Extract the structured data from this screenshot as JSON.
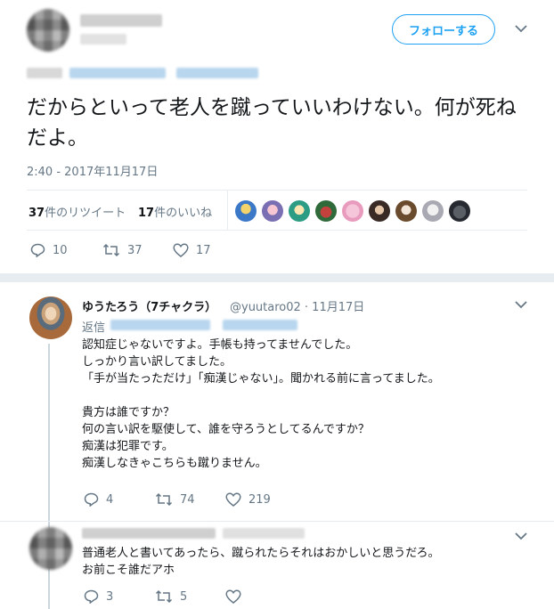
{
  "tweet": {
    "follow_label": "フォローする",
    "text": "だからといって老人を蹴っていいわけない。何が死ねだよ。",
    "timestamp": "2:40 - 2017年11月17日",
    "retweets_count": "37",
    "retweets_label": "件のリツイート",
    "likes_count": "17",
    "likes_label": "件のいいね",
    "actions": {
      "reply": "10",
      "retweet": "37",
      "like": "17"
    }
  },
  "replies": [
    {
      "name": "ゆうたろう（7チャクラ）",
      "handle": "@yuutaro02 · 11月17日",
      "reply_to": "返信",
      "body": "認知症じゃないですよ。手帳も持ってませんでした。\nしっかり言い訳してました。\n「手が当たっただけ」「痴漢じゃない」。聞かれる前に言ってました。\n\n貴方は誰ですか？\n何の言い訳を駆使して、誰を守ろうとしてるんですか？\n痴漢は犯罪です。\n痴漢しなきゃこちらも蹴りません。",
      "actions": {
        "reply": "4",
        "retweet": "74",
        "like": "219"
      }
    },
    {
      "body": "普通老人と書いてあったら、蹴られたらそれはおかしいと思うだろ。\nお前こそ誰だアホ",
      "actions": {
        "reply": "3",
        "retweet": "5",
        "like": ""
      }
    }
  ],
  "colors": {
    "accent": "#1da1f2",
    "muted": "#657786",
    "text": "#14171a",
    "border": "#e6ecf0"
  }
}
